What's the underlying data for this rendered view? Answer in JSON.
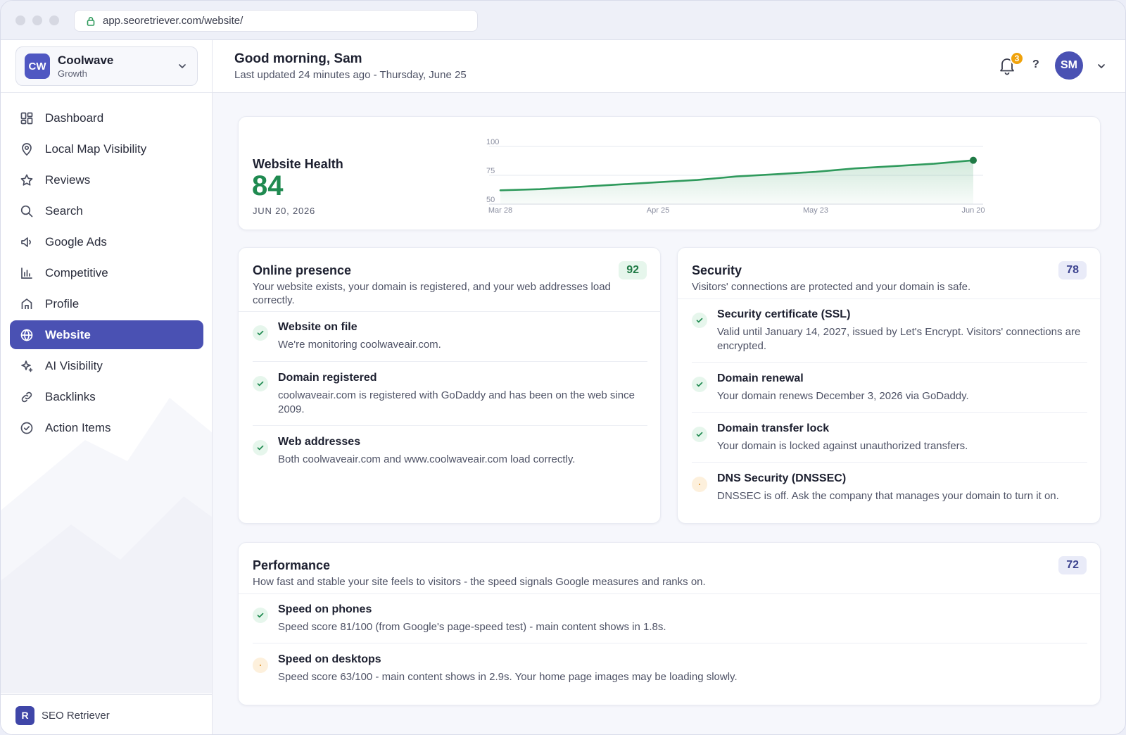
{
  "browser": {
    "url": "app.seoretriever.com/website/"
  },
  "org": {
    "initials": "CW",
    "name": "Coolwave",
    "plan": "Growth"
  },
  "sidebar": {
    "items": [
      {
        "label": "Dashboard",
        "icon": "dashboard-icon",
        "active": false
      },
      {
        "label": "Local Map Visibility",
        "icon": "map-pin-icon",
        "active": false
      },
      {
        "label": "Reviews",
        "icon": "star-icon",
        "active": false
      },
      {
        "label": "Search",
        "icon": "search-icon",
        "active": false
      },
      {
        "label": "Google Ads",
        "icon": "megaphone-icon",
        "active": false
      },
      {
        "label": "Competitive",
        "icon": "bar-chart-icon",
        "active": false
      },
      {
        "label": "Profile",
        "icon": "storefront-icon",
        "active": false
      },
      {
        "label": "Website",
        "icon": "globe-icon",
        "active": true
      },
      {
        "label": "AI Visibility",
        "icon": "sparkle-icon",
        "active": false
      },
      {
        "label": "Backlinks",
        "icon": "link-icon",
        "active": false
      },
      {
        "label": "Action Items",
        "icon": "check-circle-icon",
        "active": false
      }
    ],
    "footer": {
      "logo": "R",
      "name": "SEO Retriever"
    }
  },
  "header": {
    "greeting": "Good morning, Sam",
    "subtitle": "Last updated 24 minutes ago - Thursday, June 25",
    "notifications": "3",
    "help": "?",
    "user_initials": "SM"
  },
  "health": {
    "title": "Website Health",
    "score": "84",
    "date": "JUN 20, 2026",
    "color": "#1f8a50"
  },
  "chart_data": {
    "type": "area",
    "title": "",
    "x": [
      "Mar 28",
      "Apr 4",
      "Apr 11",
      "Apr 18",
      "Apr 25",
      "May 2",
      "May 9",
      "May 16",
      "May 23",
      "May 30",
      "Jun 6",
      "Jun 13",
      "Jun 20"
    ],
    "xticks": [
      "Mar 28",
      "Apr 25",
      "May 23",
      "Jun 20"
    ],
    "series": [
      {
        "values": [
          62,
          63,
          65,
          67,
          69,
          71,
          74,
          76,
          78,
          81,
          83,
          85,
          88
        ]
      }
    ],
    "yticks": [
      50,
      75,
      100
    ],
    "ylim": [
      50,
      100
    ],
    "grid": true,
    "color": "#2f9a5c"
  },
  "presence": {
    "title": "Online presence",
    "score": "92",
    "description": "Your website exists, your domain is registered, and your web addresses load correctly.",
    "items": [
      {
        "title": "Website on file",
        "desc": "We're monitoring coolwaveair.com.",
        "status": "ok"
      },
      {
        "title": "Domain registered",
        "desc": "coolwaveair.com is registered with GoDaddy and has been on the web since 2009.",
        "status": "ok"
      },
      {
        "title": "Web addresses",
        "desc": "Both coolwaveair.com and www.coolwaveair.com load correctly.",
        "status": "ok"
      }
    ]
  },
  "security": {
    "title": "Security",
    "score": "78",
    "description": "Visitors' connections are protected and your domain is safe.",
    "items": [
      {
        "title": "Security certificate (SSL)",
        "desc": "Valid until January 14, 2027, issued by Let's Encrypt. Visitors' connections are encrypted.",
        "status": "ok"
      },
      {
        "title": "Domain renewal",
        "desc": "Your domain renews December 3, 2026 via GoDaddy.",
        "status": "ok"
      },
      {
        "title": "Domain transfer lock",
        "desc": "Your domain is locked against unauthorized transfers.",
        "status": "ok"
      },
      {
        "title": "DNS Security (DNSSEC)",
        "desc": "DNSSEC is off. Ask the company that manages your domain to turn it on.",
        "status": "warn"
      }
    ]
  },
  "performance": {
    "title": "Performance",
    "score": "72",
    "description": "How fast and stable your site feels to visitors - the speed signals Google measures and ranks on.",
    "items": [
      {
        "title": "Speed on phones",
        "desc": "Speed score 81/100 (from Google's page-speed test) - main content shows in 1.8s.",
        "status": "ok"
      },
      {
        "title": "Speed on desktops",
        "desc": "Speed score 63/100 - main content shows in 2.9s. Your home page images may be loading slowly.",
        "status": "warn"
      }
    ]
  }
}
